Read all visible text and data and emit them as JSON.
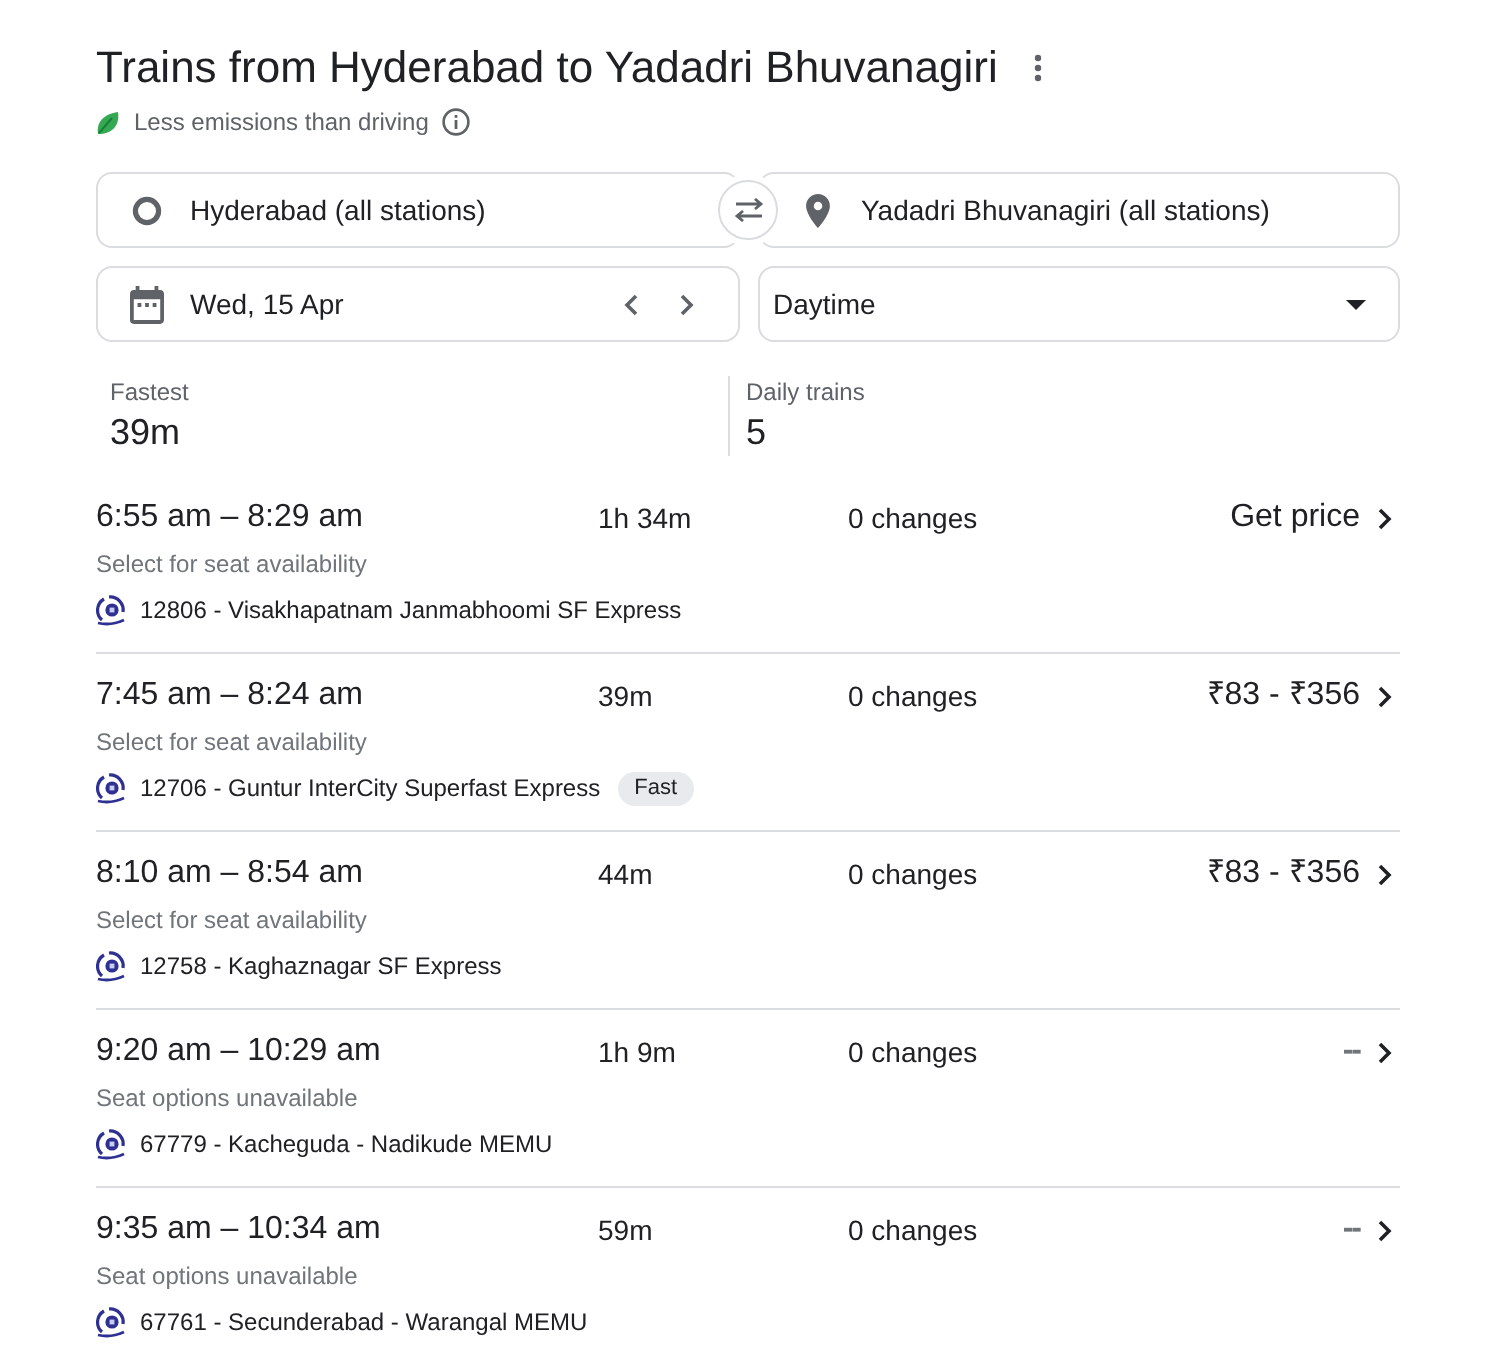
{
  "header": {
    "title": "Trains from Hyderabad to Yadadri Bhuvanagiri",
    "note": "Less emissions than driving"
  },
  "search": {
    "origin": "Hyderabad (all stations)",
    "destination": "Yadadri Bhuvanagiri (all stations)",
    "date": "Wed, 15 Apr",
    "time_of_day": "Daytime"
  },
  "summary": [
    {
      "label": "Fastest",
      "value": "39m"
    },
    {
      "label": "Daily trains",
      "value": "5"
    }
  ],
  "trips": [
    {
      "times": "6:55 am – 8:29 am",
      "duration": "1h 34m",
      "changes": "0 changes",
      "price": "Get price",
      "price_unavailable": false,
      "availability": "Select for seat availability",
      "train": "12806 - Visakhapatnam Janmabhoomi SF Express"
    },
    {
      "times": "7:45 am – 8:24 am",
      "duration": "39m",
      "changes": "0 changes",
      "price": "₹83 - ₹356",
      "price_unavailable": false,
      "availability": "Select for seat availability",
      "train": "12706 - Guntur InterCity Superfast Express",
      "badge": "Fast"
    },
    {
      "times": "8:10 am – 8:54 am",
      "duration": "44m",
      "changes": "0 changes",
      "price": "₹83 - ₹356",
      "price_unavailable": false,
      "availability": "Select for seat availability",
      "train": "12758 - Kaghaznagar SF Express"
    },
    {
      "times": "9:20 am – 10:29 am",
      "duration": "1h 9m",
      "changes": "0 changes",
      "price": "--",
      "price_unavailable": true,
      "availability": "Seat options unavailable",
      "train": "67779 - Kacheguda - Nadikude MEMU"
    },
    {
      "times": "9:35 am – 10:34 am",
      "duration": "59m",
      "changes": "0 changes",
      "price": "--",
      "price_unavailable": true,
      "availability": "Seat options unavailable",
      "train": "67761 - Secunderabad - Warangal MEMU"
    }
  ]
}
